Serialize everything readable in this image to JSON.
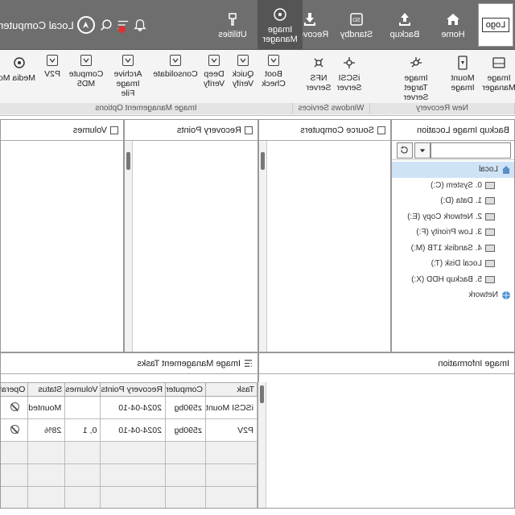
{
  "topnav": {
    "logo": "Logo",
    "home": "Home",
    "backup": "Backup",
    "standby": "Standby",
    "recovery": "Recovery",
    "image_manager": "Image Manager",
    "utilities": "Utilities",
    "local_computer": "Local Computer",
    "colors": {
      "bg": "#6e6e6e",
      "active": "#555555",
      "notification": "#e03030"
    }
  },
  "ribbon": {
    "image_manager": "Image Manager",
    "mount_image": "Mount Image",
    "image_target_server": "Image Target Server",
    "iscsi_server": "iSCSI Server",
    "nfs_server": "NFS Server",
    "boot_check": "Boot Check",
    "quick_verify": "Quick Verify",
    "deep_verify": "Deep Verify",
    "consolidate": "Consolidate",
    "archive_image_file": "Archive Image File",
    "compute_md5": "Compute MD5",
    "p2v": "P2V",
    "media_mode": "Media Mo",
    "groups": {
      "new_recovery": "New Recovery",
      "windows_services": "Windows Services",
      "image_management_options": "Image Management Options"
    }
  },
  "panels": {
    "backup_image_location": "Backup Image Location",
    "source_computers": "Source Computers",
    "recovery_points": "Recovery Points",
    "volumes": "Volumes",
    "image_information": "Image Information",
    "image_management_tasks": "Image Management Tasks"
  },
  "tree": [
    {
      "label": "Local",
      "icon": "home-icon",
      "selected": true
    },
    {
      "label": "0. System (C:)",
      "icon": "drive-icon"
    },
    {
      "label": "1. Data (D:)",
      "icon": "drive-icon"
    },
    {
      "label": "2. Network Copy (E:)",
      "icon": "drive-icon"
    },
    {
      "label": "3. Low Priority (F:)",
      "icon": "drive-icon"
    },
    {
      "label": "4. Sandisk 1TB (M:)",
      "icon": "drive-icon"
    },
    {
      "label": "Local Disk (T:)",
      "icon": "drive-icon"
    },
    {
      "label": "5. Backup HDD (X:)",
      "icon": "drive-icon"
    },
    {
      "label": "Network",
      "icon": "network-icon"
    }
  ],
  "tasks": {
    "columns": [
      "Task",
      "Computer",
      "Recovery Points",
      "Volumes",
      "Status",
      "Operatio"
    ],
    "rows": [
      {
        "task": "iSCSI Mount",
        "computer": "z590bg",
        "recovery_points": "2024-04-10",
        "volumes": "",
        "status": "Mounted",
        "op": "cancel-icon"
      },
      {
        "task": "P2V",
        "computer": "z590bg",
        "recovery_points": "2024-04-10",
        "volumes": "0, 1",
        "status": "28%",
        "op": "cancel-icon"
      }
    ]
  }
}
